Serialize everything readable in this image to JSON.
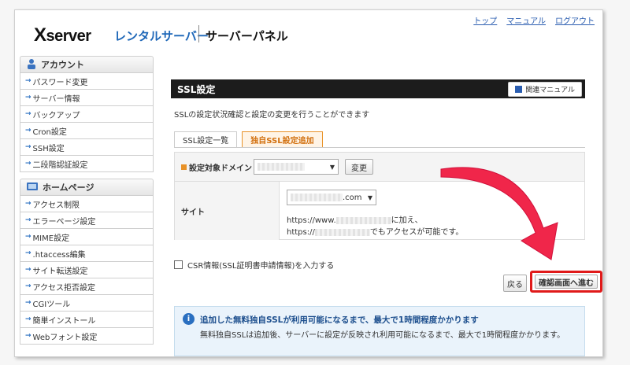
{
  "header": {
    "logo_x": "X",
    "logo_rest": "server",
    "logo_sub": "レンタルサーバー",
    "logo_panel": "サーバーパネル",
    "links": [
      "トップ",
      "マニュアル",
      "ログアウト"
    ]
  },
  "sidebar": {
    "sections": [
      {
        "title": "アカウント",
        "items": [
          "パスワード変更",
          "サーバー情報",
          "バックアップ",
          "Cron設定",
          "SSH設定",
          "二段階認証設定"
        ]
      },
      {
        "title": "ホームページ",
        "items": [
          "アクセス制限",
          "エラーページ設定",
          "MIME設定",
          ".htaccess編集",
          "サイト転送設定",
          "アクセス拒否設定",
          "CGIツール",
          "簡単インストール",
          "Webフォント設定"
        ]
      }
    ]
  },
  "main": {
    "title": "SSL設定",
    "manual_label": "関連マニュアル",
    "description": "SSLの設定状況確認と設定の変更を行うことができます",
    "tabs": [
      "SSL設定一覧",
      "独自SSL設定追加"
    ],
    "domain_label": "設定対象ドメイン",
    "change_label": "変更",
    "site_label": "サイト",
    "site_select": ".com",
    "site_line1_prefix": "https://www.",
    "site_line1_suffix": "に加え、",
    "site_line2_prefix": "https://",
    "site_line2_suffix": "でもアクセスが可能です。",
    "csr_label": "CSR情報(SSL証明書申請情報)を入力する",
    "back_label": "戻る",
    "confirm_label": "確認画面へ進む",
    "notice_title": "追加した無料独自SSLが利用可能になるまで、最大で1時間程度かかります",
    "notice_body": "無料独自SSLは追加後、サーバーに設定が反映され利用可能になるまで、最大で1時間程度かかります。"
  },
  "colors": {
    "accent": "#e89228",
    "link": "#2a5db0",
    "highlight": "#e01a1a",
    "arrow": "#f0264a"
  }
}
